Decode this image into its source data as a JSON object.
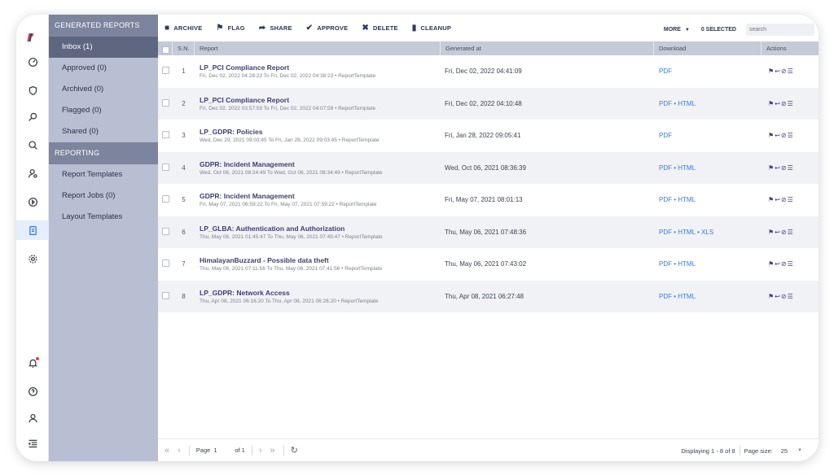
{
  "logo": "LP",
  "sidebar": {
    "section1": "GENERATED REPORTS",
    "items1": [
      {
        "label": "Inbox (1)"
      },
      {
        "label": "Approved (0)"
      },
      {
        "label": "Archived (0)"
      },
      {
        "label": "Flagged (0)"
      },
      {
        "label": "Shared (0)"
      }
    ],
    "section2": "REPORTING",
    "items2": [
      {
        "label": "Report Templates"
      },
      {
        "label": "Report Jobs (0)"
      },
      {
        "label": "Layout Templates"
      }
    ]
  },
  "toolbar": {
    "archive": "ARCHIVE",
    "flag": "FLAG",
    "share": "SHARE",
    "approve": "APPROVE",
    "delete": "DELETE",
    "cleanup": "CLEANUP",
    "more": "MORE",
    "selected": "0 SELECTED",
    "search_placeholder": "search"
  },
  "table": {
    "headers": {
      "sn": "S.N.",
      "report": "Report",
      "generated": "Generated at",
      "download": "Download",
      "actions": "Actions"
    },
    "rows": [
      {
        "sn": "1",
        "title": "LP_PCI Compliance Report",
        "sub": "Fri, Dec 02, 2022 04:28:23 To Fri, Dec 02, 2022 04:38:23 • ReportTemplate",
        "generated": "Fri, Dec 02, 2022 04:41:09",
        "download": "PDF"
      },
      {
        "sn": "2",
        "title": "LP_PCI Compliance Report",
        "sub": "Fri, Dec 02, 2022 03:57:59 To Fri, Dec 02, 2022 04:07:59 • ReportTemplate",
        "generated": "Fri, Dec 02, 2022 04:10:48",
        "download": "PDF • HTML"
      },
      {
        "sn": "3",
        "title": "LP_GDPR: Policies",
        "sub": "Wed, Dec 29, 2021 09:03:45 To Fri, Jan 28, 2022 09:03:45 • ReportTemplate",
        "generated": "Fri, Jan 28, 2022 09:05:41",
        "download": "PDF"
      },
      {
        "sn": "4",
        "title": "GDPR: Incident Management",
        "sub": "Wed, Oct 06, 2021 08:24:49 To Wed, Oct 06, 2021 08:34:49 • ReportTemplate",
        "generated": "Wed, Oct 06, 2021 08:36:39",
        "download": "PDF • HTML"
      },
      {
        "sn": "5",
        "title": "GDPR: Incident Management",
        "sub": "Fri, May 07, 2021 06:59:22 To Fri, May 07, 2021 07:59:22 • ReportTemplate",
        "generated": "Fri, May 07, 2021 08:01:13",
        "download": "PDF • HTML"
      },
      {
        "sn": "6",
        "title": "LP_GLBA: Authentication and Authorization",
        "sub": "Thu, May 06, 2021 01:45:47 To Thu, May 06, 2021 07:45:47 • ReportTemplate",
        "generated": "Thu, May 06, 2021 07:48:36",
        "download": "PDF • HTML • XLS"
      },
      {
        "sn": "7",
        "title": "HimalayanBuzzard - Possible data theft",
        "sub": "Thu, May 06, 2021 07:11:56 To Thu, May 06, 2021 07:41:56 • ReportTemplate",
        "generated": "Thu, May 06, 2021 07:43:02",
        "download": "PDF • HTML"
      },
      {
        "sn": "8",
        "title": "LP_GDPR: Network Access",
        "sub": "Thu, Apr 08, 2021 06:16:20 To Thu, Apr 08, 2021 06:26:20 • ReportTemplate",
        "generated": "Thu, Apr 08, 2021 06:27:48",
        "download": "PDF • HTML"
      }
    ]
  },
  "pager": {
    "page_label": "Page",
    "page_value": "1",
    "of_label": "of 1",
    "displaying": "Displaying 1 - 8 of 8",
    "page_size_label": "Page size:",
    "page_size": "25"
  },
  "colors": {
    "accent": "#3a78e6",
    "sidebar": "#b9bfd3",
    "sidebar_active": "#5f6780",
    "section": "#7c849e"
  }
}
